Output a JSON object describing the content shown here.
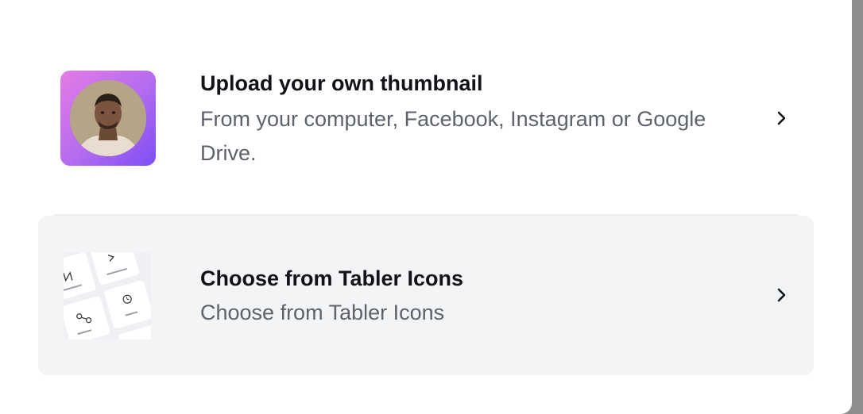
{
  "options": [
    {
      "title": "Upload your own thumbnail",
      "description": "From your computer, Facebook, Instagram or Google Drive.",
      "thumbnail_icon": "user-avatar-photo",
      "chevron_icon": "chevron-right-icon"
    },
    {
      "title": "Choose from Tabler Icons",
      "description": "Choose from Tabler Icons",
      "thumbnail_icon": "tabler-icons-grid-preview",
      "chevron_icon": "chevron-right-icon"
    }
  ],
  "colors": {
    "upload_gradient_start": "#e57be6",
    "upload_gradient_end": "#7d4ef4",
    "selected_background": "#f3f4f6"
  }
}
